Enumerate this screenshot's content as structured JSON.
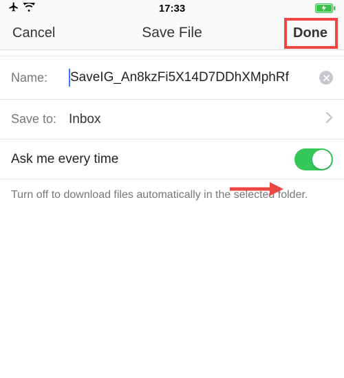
{
  "status": {
    "time": "17:33"
  },
  "nav": {
    "cancel": "Cancel",
    "title": "Save File",
    "done": "Done"
  },
  "nameRow": {
    "label": "Name:",
    "value": "SaveIG_An8kzFi5X14D7DDhXMphRf"
  },
  "saveToRow": {
    "label": "Save to:",
    "value": "Inbox"
  },
  "toggleRow": {
    "label": "Ask me every time",
    "on": true
  },
  "footer": "Turn off to download files automatically in the selected folder."
}
